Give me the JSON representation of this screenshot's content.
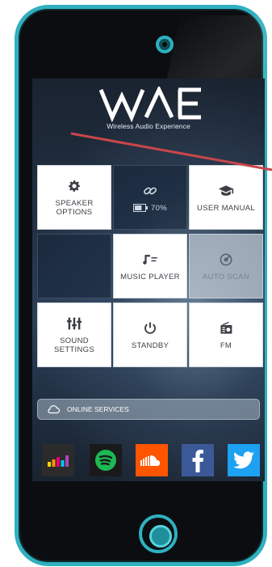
{
  "app": {
    "logo_text": "WAE",
    "tagline": "Wireless Audio Experience"
  },
  "tiles": {
    "speaker_options": "SPEAKER\nOPTIONS",
    "battery": "70%",
    "user_manual": "USER MANUAL",
    "music_player": "MUSIC PLAYER",
    "auto_scan": "AUTO SCAN",
    "sound_settings": "SOUND\nSETTINGS",
    "standby": "STANDBY",
    "fm": "FM"
  },
  "battery_level": 0.7,
  "online_services": {
    "label": "ONLINE SERVICES"
  },
  "services": [
    {
      "name": "deezer-icon",
      "color": "#2a2a2a"
    },
    {
      "name": "spotify-icon",
      "color": "#1db954"
    },
    {
      "name": "soundcloud-icon",
      "color": "#ff5500"
    },
    {
      "name": "facebook-icon",
      "color": "#3b5998"
    },
    {
      "name": "twitter-icon",
      "color": "#1da1f2"
    }
  ],
  "colors": {
    "device_border": "#2fb0bf",
    "annotation_line": "#c8464a"
  }
}
